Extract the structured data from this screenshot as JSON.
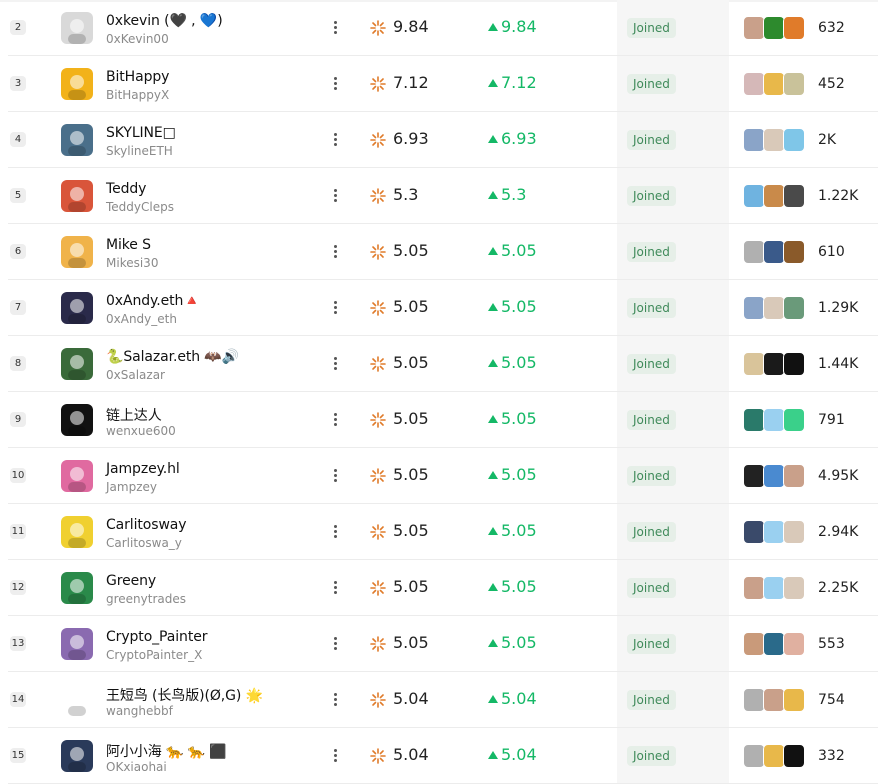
{
  "columns": {
    "menu_icon": "more-vertical-icon",
    "score_icon": "sparkle-icon",
    "change_icon": "arrow-up-icon"
  },
  "colors": {
    "up": "#14b866",
    "joined_bg": "#e6efe8",
    "joined_text": "#3f8a5a"
  },
  "rows": [
    {
      "rank": "2",
      "name": "0xkevin (🖤 , 💙)",
      "handle": "0xKevin00",
      "score": "9.84",
      "change": "9.84",
      "status": "Joined",
      "followers": "632",
      "avatar": "#d9d9d9",
      "mini": [
        "#c9a08a",
        "#2d8a2d",
        "#e07b2a"
      ]
    },
    {
      "rank": "3",
      "name": "BitHappy",
      "handle": "BitHappyX",
      "score": "7.12",
      "change": "7.12",
      "status": "Joined",
      "followers": "452",
      "avatar": "#f2b21a",
      "mini": [
        "#d5b8b8",
        "#e8b84a",
        "#c9c29a"
      ]
    },
    {
      "rank": "4",
      "name": "SKYLINE□",
      "handle": "SkylineETH",
      "score": "6.93",
      "change": "6.93",
      "status": "Joined",
      "followers": "2K",
      "avatar": "#4a6f8a",
      "mini": [
        "#8aa4c8",
        "#d9c9b9",
        "#7fc6e8"
      ]
    },
    {
      "rank": "5",
      "name": "Teddy",
      "handle": "TeddyCleps",
      "score": "5.3",
      "change": "5.3",
      "status": "Joined",
      "followers": "1.22K",
      "avatar": "#d9553a",
      "mini": [
        "#6fb3e0",
        "#c98a4a",
        "#4a4a4a"
      ]
    },
    {
      "rank": "6",
      "name": "Mike S",
      "handle": "Mikesi30",
      "score": "5.05",
      "change": "5.05",
      "status": "Joined",
      "followers": "610",
      "avatar": "#f0b34a",
      "mini": [
        "#b0b0b0",
        "#3a5a8a",
        "#8a5a2a"
      ]
    },
    {
      "rank": "7",
      "name": "0xAndy.eth🔺",
      "handle": "0xAndy_eth",
      "score": "5.05",
      "change": "5.05",
      "status": "Joined",
      "followers": "1.29K",
      "avatar": "#2a2a4a",
      "mini": [
        "#8aa4c8",
        "#d9c9b9",
        "#6a9a7a"
      ]
    },
    {
      "rank": "8",
      "name": "🐍Salazar.eth 🦇🔊",
      "handle": "0xSalazar",
      "score": "5.05",
      "change": "5.05",
      "status": "Joined",
      "followers": "1.44K",
      "avatar": "#3a6a3a",
      "mini": [
        "#d9c49a",
        "#1a1a1a",
        "#111111"
      ]
    },
    {
      "rank": "9",
      "name": "链上达人",
      "handle": "wenxue600",
      "score": "5.05",
      "change": "5.05",
      "status": "Joined",
      "followers": "791",
      "avatar": "#111111",
      "mini": [
        "#2a7a6a",
        "#9ad0f0",
        "#3ad08a"
      ]
    },
    {
      "rank": "10",
      "name": "Jampzey.hl",
      "handle": "Jampzey",
      "score": "5.05",
      "change": "5.05",
      "status": "Joined",
      "followers": "4.95K",
      "avatar": "#e06aa0",
      "mini": [
        "#222222",
        "#4a8ad0",
        "#c9a08a"
      ]
    },
    {
      "rank": "11",
      "name": "Carlitosway",
      "handle": "Carlitoswa_y",
      "score": "5.05",
      "change": "5.05",
      "status": "Joined",
      "followers": "2.94K",
      "avatar": "#f0d030",
      "mini": [
        "#3a4a6a",
        "#9ad0f0",
        "#d9c9b9"
      ]
    },
    {
      "rank": "12",
      "name": "Greeny",
      "handle": "greenytrades",
      "score": "5.05",
      "change": "5.05",
      "status": "Joined",
      "followers": "2.25K",
      "avatar": "#2a8a4a",
      "mini": [
        "#c9a08a",
        "#9ad0f0",
        "#d9c9b9"
      ]
    },
    {
      "rank": "13",
      "name": "Crypto_Painter",
      "handle": "CryptoPainter_X",
      "score": "5.05",
      "change": "5.05",
      "status": "Joined",
      "followers": "553",
      "avatar": "#8a6ab0",
      "mini": [
        "#c99a7a",
        "#2a6a8a",
        "#e0b0a0"
      ]
    },
    {
      "rank": "14",
      "name": "王短鸟 (长鸟版)(Ø,G) 🌟",
      "handle": "wanghebbf",
      "score": "5.04",
      "change": "5.04",
      "status": "Joined",
      "followers": "754",
      "avatar": "#ffffff",
      "mini": [
        "#b0b0b0",
        "#c9a08a",
        "#e8b84a"
      ]
    },
    {
      "rank": "15",
      "name": "阿小小海 🐆 🐆 ⬛",
      "handle": "OKxiaohai",
      "score": "5.04",
      "change": "5.04",
      "status": "Joined",
      "followers": "332",
      "avatar": "#2a3a5a",
      "mini": [
        "#b0b0b0",
        "#e8b84a",
        "#111111"
      ]
    }
  ]
}
